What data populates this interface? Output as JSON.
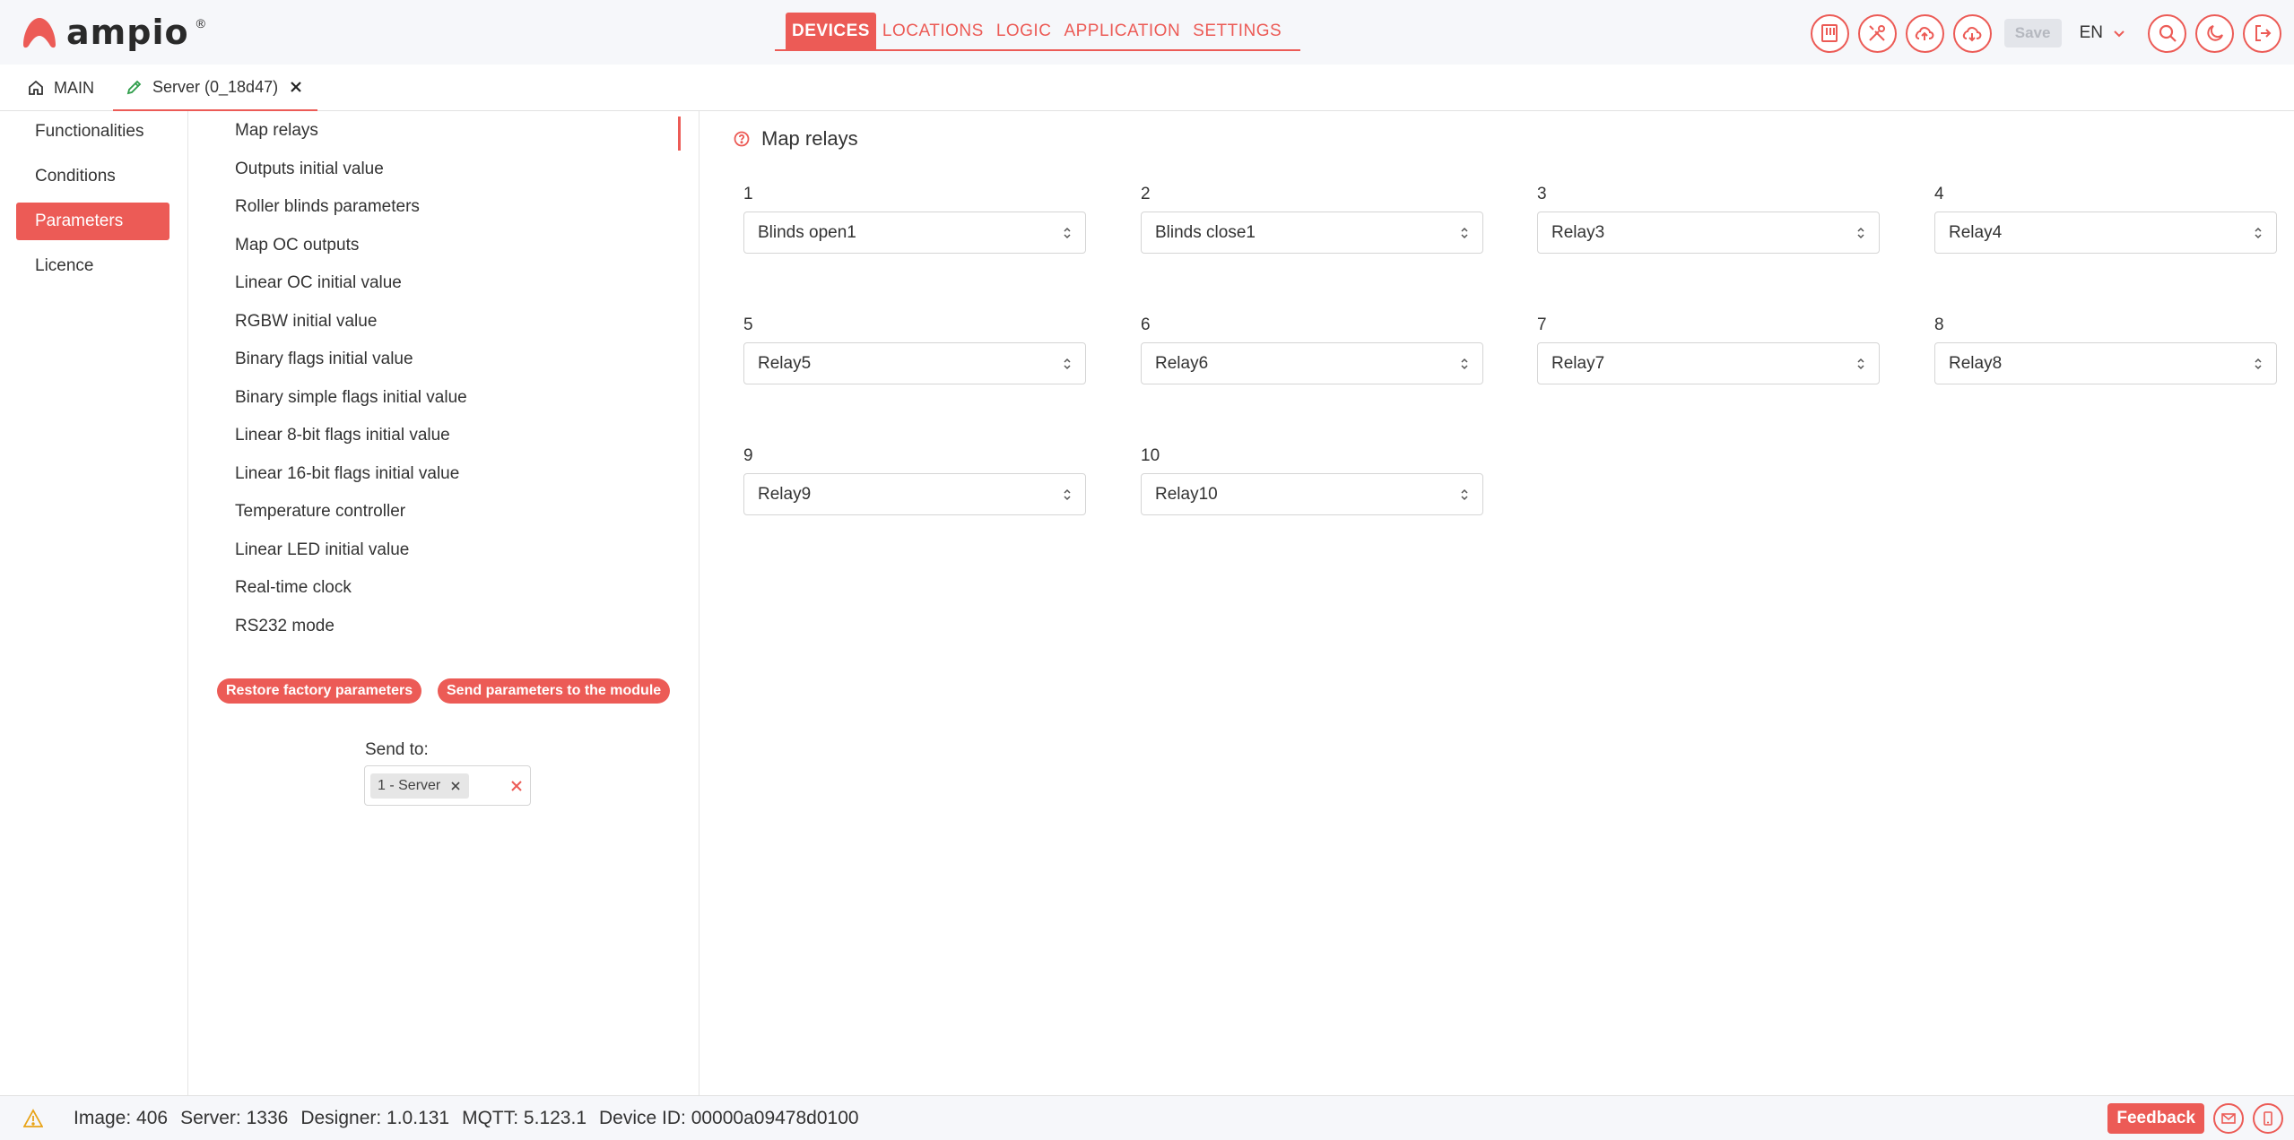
{
  "brand": {
    "name": "ampio",
    "tm": "®"
  },
  "topnav": {
    "items": [
      "DEVICES",
      "LOCATIONS",
      "LOGIC",
      "APPLICATION",
      "SETTINGS"
    ]
  },
  "header": {
    "save_label": "Save",
    "language": "EN"
  },
  "tabs": {
    "main": "MAIN",
    "server": "Server (0_18d47)"
  },
  "leftnav": {
    "items": [
      "Functionalities",
      "Conditions",
      "Parameters",
      "Licence"
    ]
  },
  "params": {
    "items": [
      "Map relays",
      "Outputs initial value",
      "Roller blinds parameters",
      "Map OC outputs",
      "Linear OC initial value",
      "RGBW initial value",
      "Binary flags initial value",
      "Binary simple flags initial value",
      "Linear 8-bit flags initial value",
      "Linear 16-bit flags initial value",
      "Temperature controller",
      "Linear LED initial value",
      "Real-time clock",
      "RS232 mode"
    ],
    "restore_label": "Restore factory parameters",
    "send_label": "Send parameters to the module",
    "send_to_label": "Send to:",
    "send_to_chip": "1 - Server"
  },
  "main": {
    "title": "Map relays",
    "relays": [
      {
        "num": "1",
        "value": "Blinds open1"
      },
      {
        "num": "2",
        "value": "Blinds close1"
      },
      {
        "num": "3",
        "value": "Relay3"
      },
      {
        "num": "4",
        "value": "Relay4"
      },
      {
        "num": "5",
        "value": "Relay5"
      },
      {
        "num": "6",
        "value": "Relay6"
      },
      {
        "num": "7",
        "value": "Relay7"
      },
      {
        "num": "8",
        "value": "Relay8"
      },
      {
        "num": "9",
        "value": "Relay9"
      },
      {
        "num": "10",
        "value": "Relay10"
      }
    ]
  },
  "footer": {
    "image": "Image: 406",
    "server": "Server: 1336",
    "designer": "Designer: 1.0.131",
    "mqtt": "MQTT: 5.123.1",
    "device_id": "Device ID: 00000a09478d0100",
    "feedback_label": "Feedback"
  },
  "colors": {
    "accent": "#ec5b56",
    "header_bg": "#f6f7fa"
  }
}
